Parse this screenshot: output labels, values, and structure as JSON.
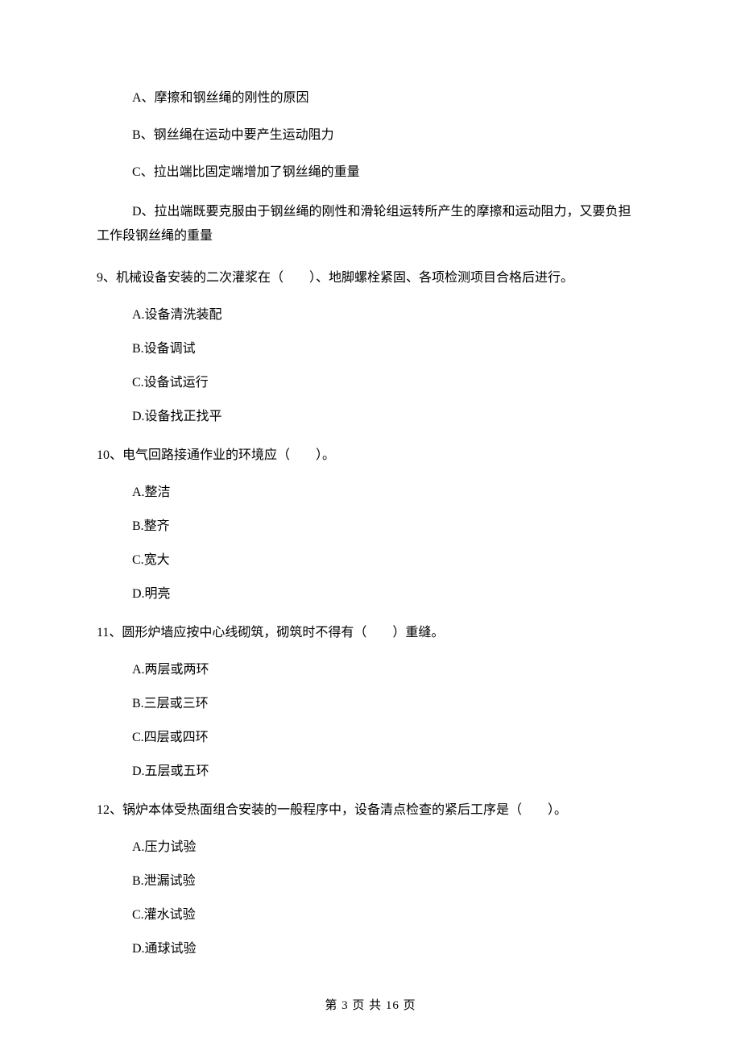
{
  "prelude": {
    "optA": "A、摩擦和钢丝绳的刚性的原因",
    "optB": "B、钢丝绳在运动中要产生运动阻力",
    "optC": "C、拉出端比固定端增加了钢丝绳的重量",
    "optD_line1": "D、拉出端既要克服由于钢丝绳的刚性和滑轮组运转所产生的摩擦和运动阻力，又要负担",
    "optD_line2": "工作段钢丝绳的重量"
  },
  "q9": {
    "stem": "9、机械设备安装的二次灌浆在（　　）、地脚螺栓紧固、各项检测项目合格后进行。",
    "A": "A.设备清洗装配",
    "B": "B.设备调试",
    "C": "C.设备试运行",
    "D": "D.设备找正找平"
  },
  "q10": {
    "stem": "10、电气回路接通作业的环境应（　　）。",
    "A": "A.整洁",
    "B": "B.整齐",
    "C": "C.宽大",
    "D": "D.明亮"
  },
  "q11": {
    "stem": "11、圆形炉墙应按中心线砌筑，砌筑时不得有（　　）重缝。",
    "A": "A.两层或两环",
    "B": "B.三层或三环",
    "C": "C.四层或四环",
    "D": "D.五层或五环"
  },
  "q12": {
    "stem": "12、锅炉本体受热面组合安装的一般程序中，设备清点检查的紧后工序是（　　）。",
    "A": "A.压力试验",
    "B": "B.泄漏试验",
    "C": "C.灌水试验",
    "D": "D.通球试验"
  },
  "footer": "第 3 页 共 16 页"
}
